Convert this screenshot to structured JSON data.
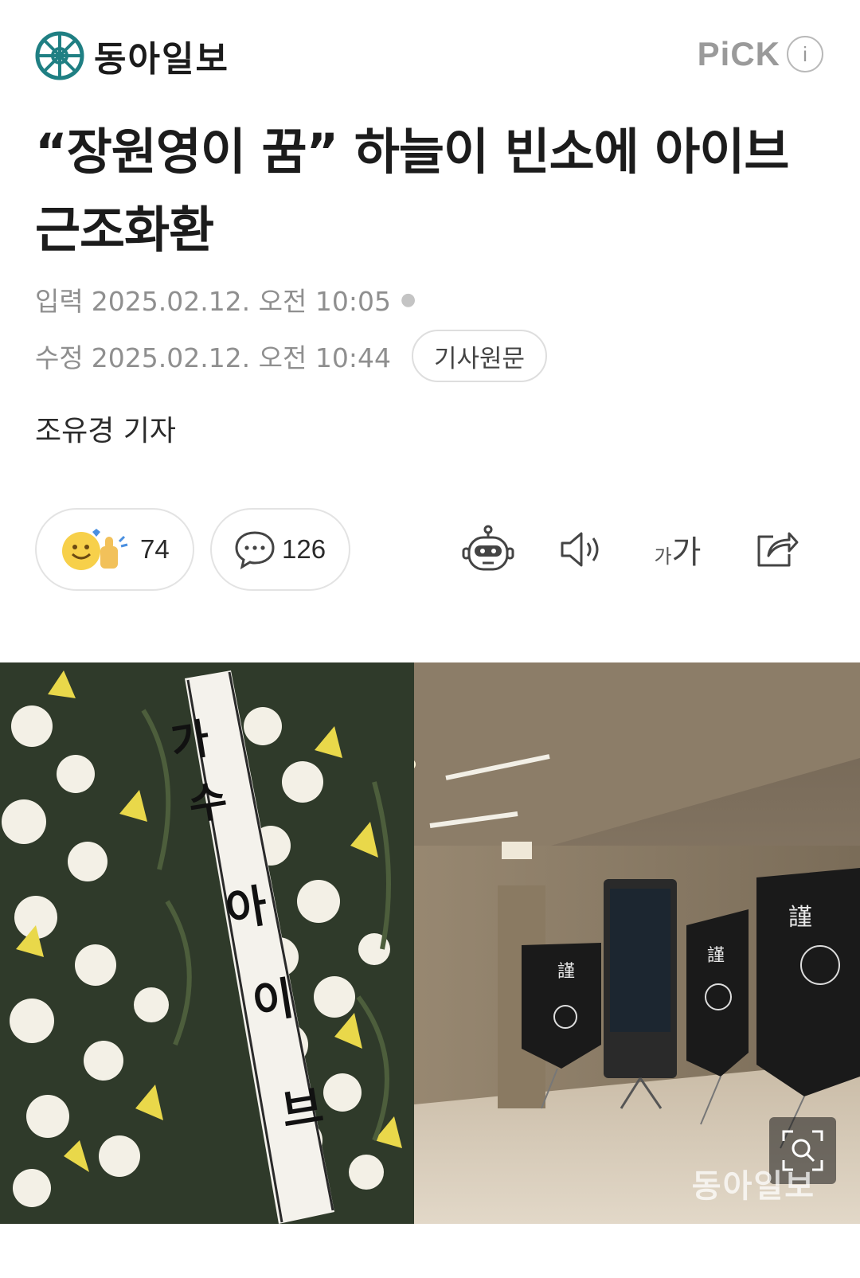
{
  "header": {
    "brand_name": "동아일보",
    "pick_label": "PiCK",
    "info_glyph": "i"
  },
  "article": {
    "headline": "“장원영이 꿈” 하늘이 빈소에 아이브 근조화환",
    "input_label": "입력",
    "input_datetime": "2025.02.12. 오전 10:05",
    "edit_label": "수정",
    "edit_datetime": "2025.02.12. 오전 10:44",
    "original_button": "기사원문",
    "reporter": "조유경 기자"
  },
  "actions": {
    "reaction_count": "74",
    "comment_count": "126",
    "font_small": "가",
    "font_big": "가",
    "icons": [
      "reaction-emoji-icon",
      "comment-bubble-icon",
      "robot-summary-icon",
      "speaker-icon",
      "font-size-icon",
      "share-icon"
    ]
  },
  "photo": {
    "ribbon_text": "가수 아이브",
    "watermark": "동아일보",
    "zoom_icon": "zoom-search-icon"
  },
  "colors": {
    "brand_teal": "#1f7f83",
    "text_dark": "#1c1c1c",
    "meta_gray": "#8f8f8f",
    "border_gray": "#e3e3e3"
  }
}
